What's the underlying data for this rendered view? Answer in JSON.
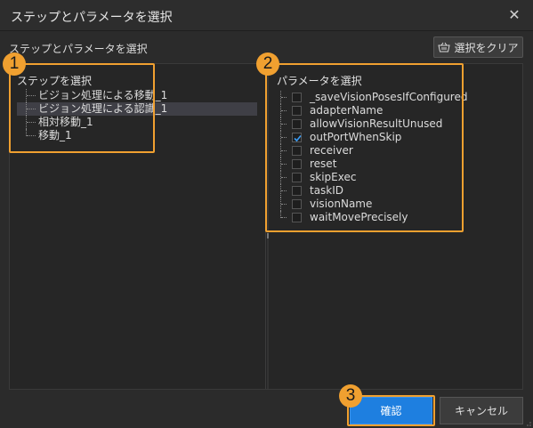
{
  "window": {
    "title": "ステップとパラメータを選択",
    "close_glyph": "✕"
  },
  "subtitle": "ステップとパラメータを選択",
  "clear_button": {
    "label": "選択をクリア",
    "icon": "basket-icon"
  },
  "steps": {
    "header": "ステップを選択",
    "items": [
      {
        "label": "ビジョン処理による移動_1",
        "selected": false
      },
      {
        "label": "ビジョン処理による認識_1",
        "selected": true
      },
      {
        "label": "相対移動_1",
        "selected": false
      },
      {
        "label": "移動_1",
        "selected": false
      }
    ]
  },
  "params": {
    "header": "パラメータを選択",
    "items": [
      {
        "label": "_saveVisionPosesIfConfigured",
        "checked": false
      },
      {
        "label": "adapterName",
        "checked": false
      },
      {
        "label": "allowVisionResultUnused",
        "checked": false
      },
      {
        "label": "outPortWhenSkip",
        "checked": true
      },
      {
        "label": "receiver",
        "checked": false
      },
      {
        "label": "reset",
        "checked": false
      },
      {
        "label": "skipExec",
        "checked": false
      },
      {
        "label": "taskID",
        "checked": false
      },
      {
        "label": "visionName",
        "checked": false
      },
      {
        "label": "waitMovePrecisely",
        "checked": false
      }
    ]
  },
  "footer": {
    "ok_label": "確認",
    "cancel_label": "キャンセル"
  },
  "annotations": {
    "badge_1": "1",
    "badge_2": "2",
    "badge_3": "3"
  },
  "colors": {
    "background": "#2b2b2b",
    "accent": "#1e7fe0",
    "highlight": "#f0a030",
    "selection": "#3f3f46"
  }
}
